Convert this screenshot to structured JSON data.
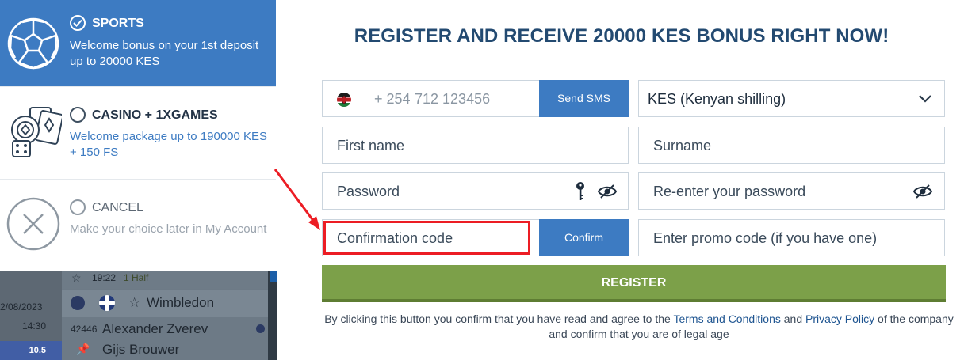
{
  "left_panel": {
    "options": [
      {
        "title": "SPORTS",
        "description": "Welcome bonus on your 1st deposit up to 20000 KES",
        "icon": "football-icon",
        "selected": true
      },
      {
        "title": "CASINO + 1XGAMES",
        "description": "Welcome package up to 190000 KES + 150 FS",
        "icon": "casino-cards-dice-icon",
        "selected": false
      },
      {
        "title": "CANCEL",
        "description": "Make your choice later in My Account",
        "icon": "cancel-x-icon",
        "selected": false
      }
    ],
    "background": {
      "time": "19:22",
      "half": "1 Half",
      "date": "2/08/2023",
      "clock": "14:30",
      "odds": "10.5",
      "event": "Wimbledon",
      "match_id": "42446",
      "player1": "Alexander Zverev",
      "player2": "Gijs Brouwer"
    }
  },
  "headline": "REGISTER AND RECEIVE 20000 KES BONUS RIGHT NOW!",
  "form": {
    "phone_prefix": "+ 254",
    "phone_placeholder": "712 123456",
    "send_sms_label": "Send SMS",
    "currency_value": "KES (Kenyan shilling)",
    "first_name_placeholder": "First name",
    "surname_placeholder": "Surname",
    "password_placeholder": "Password",
    "reenter_password_placeholder": "Re-enter your password",
    "confirmation_code_placeholder": "Confirmation code",
    "confirm_label": "Confirm",
    "promo_placeholder": "Enter promo code (if you have one)",
    "register_label": "REGISTER",
    "terms_pre": "By clicking this button you confirm that you have read and agree to the",
    "terms_link": "Terms and Conditions",
    "terms_and": "and",
    "privacy_link": "Privacy Policy",
    "terms_post": "of the company and confirm that you are of legal age"
  },
  "colors": {
    "accent_blue": "#3d7bc2",
    "headline_navy": "#234a71",
    "register_green": "#7ca049",
    "annotation_red": "#ec1d24"
  }
}
